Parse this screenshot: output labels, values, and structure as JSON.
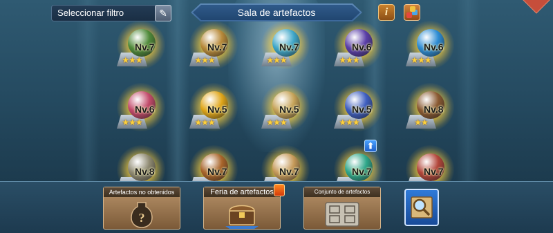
{
  "header": {
    "filter_label": "Seleccionar filtro",
    "title": "Sala de artefactos",
    "info_icon": "info-icon",
    "pack_icon": "gift-pack-icon",
    "filter_icon": "quill-icon"
  },
  "colors": {
    "glow": "#ffd84a",
    "star": "#ffd23a",
    "title_banner": "#3b679a",
    "background": "#24495f",
    "card": "#9c7a52"
  },
  "artifacts": [
    {
      "level": "Nv.7",
      "stars": "★★★",
      "color": "#4f8a3a",
      "icon": "green-orb-icon",
      "up": false
    },
    {
      "level": "Nv.7",
      "stars": "★★★",
      "color": "#b88a3a",
      "icon": "torch-icon",
      "up": false
    },
    {
      "level": "Nv.7",
      "stars": "★★★",
      "color": "#3fa7c9",
      "icon": "compass-icon",
      "up": false
    },
    {
      "level": "Nv.6",
      "stars": "★★★",
      "color": "#5a3ea8",
      "icon": "purple-mask-icon",
      "up": false
    },
    {
      "level": "Nv.6",
      "stars": "★★★",
      "color": "#2d8cd4",
      "icon": "blue-amulet-icon",
      "up": false
    },
    {
      "level": "Nv.6",
      "stars": "★★★",
      "color": "#c24a6a",
      "icon": "crimson-flower-icon",
      "up": false
    },
    {
      "level": "Nv.5",
      "stars": "★★★",
      "color": "#e0a61a",
      "icon": "golden-apple-icon",
      "up": false
    },
    {
      "level": "Nv.5",
      "stars": "★★★",
      "color": "#c7a45a",
      "icon": "hourglass-icon",
      "up": false
    },
    {
      "level": "Nv.5",
      "stars": "★★★",
      "color": "#3e5ec0",
      "icon": "blue-potion-icon",
      "up": false
    },
    {
      "level": "Nv.8",
      "stars": "★★",
      "color": "#8a5a32",
      "icon": "gear-book-icon",
      "up": false
    },
    {
      "level": "Nv.8",
      "stars": "",
      "color": "#8f8a72",
      "icon": "hammer-icon",
      "up": false
    },
    {
      "level": "Nv.7",
      "stars": "",
      "color": "#a8642a",
      "icon": "tome-stack-icon",
      "up": false
    },
    {
      "level": "Nv.7",
      "stars": "",
      "color": "#c69a5a",
      "icon": "open-scroll-icon",
      "up": false
    },
    {
      "level": "Nv.7",
      "stars": "",
      "color": "#2fa78a",
      "icon": "teal-vial-icon",
      "up": true
    },
    {
      "level": "Nv.7",
      "stars": "",
      "color": "#b2463a",
      "icon": "red-book-icon",
      "up": false
    }
  ],
  "bottom": {
    "unobtained": "Artefactos no obtenidos",
    "fair": "Feria de artefactos",
    "sets": "Conjunto de artefactos",
    "unobtained_icon": "question-vase-icon",
    "fair_icon": "treasure-chest-icon",
    "sets_icon": "rune-tablet-icon",
    "map_icon": "magnifier-map-icon"
  }
}
